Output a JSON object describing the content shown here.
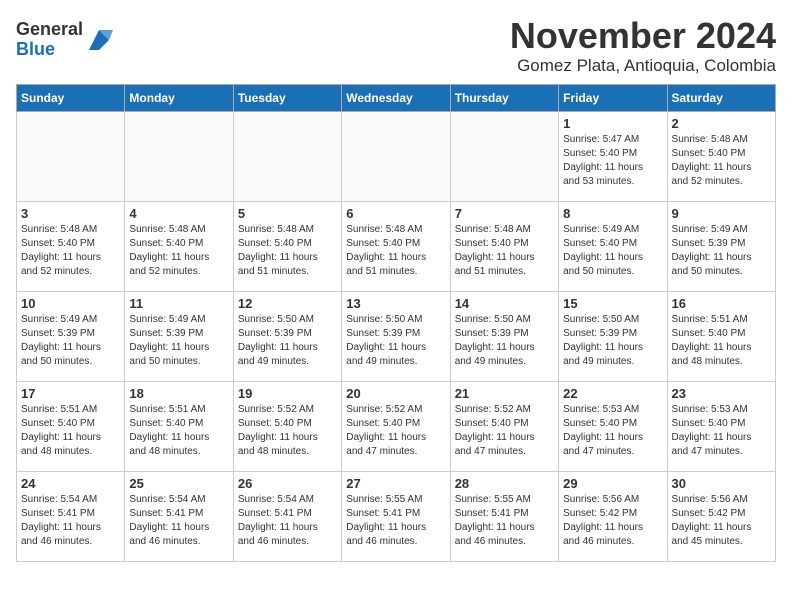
{
  "logo": {
    "general": "General",
    "blue": "Blue"
  },
  "title": "November 2024",
  "location": "Gomez Plata, Antioquia, Colombia",
  "days_of_week": [
    "Sunday",
    "Monday",
    "Tuesday",
    "Wednesday",
    "Thursday",
    "Friday",
    "Saturday"
  ],
  "weeks": [
    [
      {
        "day": "",
        "info": ""
      },
      {
        "day": "",
        "info": ""
      },
      {
        "day": "",
        "info": ""
      },
      {
        "day": "",
        "info": ""
      },
      {
        "day": "",
        "info": ""
      },
      {
        "day": "1",
        "info": "Sunrise: 5:47 AM\nSunset: 5:40 PM\nDaylight: 11 hours\nand 53 minutes."
      },
      {
        "day": "2",
        "info": "Sunrise: 5:48 AM\nSunset: 5:40 PM\nDaylight: 11 hours\nand 52 minutes."
      }
    ],
    [
      {
        "day": "3",
        "info": "Sunrise: 5:48 AM\nSunset: 5:40 PM\nDaylight: 11 hours\nand 52 minutes."
      },
      {
        "day": "4",
        "info": "Sunrise: 5:48 AM\nSunset: 5:40 PM\nDaylight: 11 hours\nand 52 minutes."
      },
      {
        "day": "5",
        "info": "Sunrise: 5:48 AM\nSunset: 5:40 PM\nDaylight: 11 hours\nand 51 minutes."
      },
      {
        "day": "6",
        "info": "Sunrise: 5:48 AM\nSunset: 5:40 PM\nDaylight: 11 hours\nand 51 minutes."
      },
      {
        "day": "7",
        "info": "Sunrise: 5:48 AM\nSunset: 5:40 PM\nDaylight: 11 hours\nand 51 minutes."
      },
      {
        "day": "8",
        "info": "Sunrise: 5:49 AM\nSunset: 5:40 PM\nDaylight: 11 hours\nand 50 minutes."
      },
      {
        "day": "9",
        "info": "Sunrise: 5:49 AM\nSunset: 5:39 PM\nDaylight: 11 hours\nand 50 minutes."
      }
    ],
    [
      {
        "day": "10",
        "info": "Sunrise: 5:49 AM\nSunset: 5:39 PM\nDaylight: 11 hours\nand 50 minutes."
      },
      {
        "day": "11",
        "info": "Sunrise: 5:49 AM\nSunset: 5:39 PM\nDaylight: 11 hours\nand 50 minutes."
      },
      {
        "day": "12",
        "info": "Sunrise: 5:50 AM\nSunset: 5:39 PM\nDaylight: 11 hours\nand 49 minutes."
      },
      {
        "day": "13",
        "info": "Sunrise: 5:50 AM\nSunset: 5:39 PM\nDaylight: 11 hours\nand 49 minutes."
      },
      {
        "day": "14",
        "info": "Sunrise: 5:50 AM\nSunset: 5:39 PM\nDaylight: 11 hours\nand 49 minutes."
      },
      {
        "day": "15",
        "info": "Sunrise: 5:50 AM\nSunset: 5:39 PM\nDaylight: 11 hours\nand 49 minutes."
      },
      {
        "day": "16",
        "info": "Sunrise: 5:51 AM\nSunset: 5:40 PM\nDaylight: 11 hours\nand 48 minutes."
      }
    ],
    [
      {
        "day": "17",
        "info": "Sunrise: 5:51 AM\nSunset: 5:40 PM\nDaylight: 11 hours\nand 48 minutes."
      },
      {
        "day": "18",
        "info": "Sunrise: 5:51 AM\nSunset: 5:40 PM\nDaylight: 11 hours\nand 48 minutes."
      },
      {
        "day": "19",
        "info": "Sunrise: 5:52 AM\nSunset: 5:40 PM\nDaylight: 11 hours\nand 48 minutes."
      },
      {
        "day": "20",
        "info": "Sunrise: 5:52 AM\nSunset: 5:40 PM\nDaylight: 11 hours\nand 47 minutes."
      },
      {
        "day": "21",
        "info": "Sunrise: 5:52 AM\nSunset: 5:40 PM\nDaylight: 11 hours\nand 47 minutes."
      },
      {
        "day": "22",
        "info": "Sunrise: 5:53 AM\nSunset: 5:40 PM\nDaylight: 11 hours\nand 47 minutes."
      },
      {
        "day": "23",
        "info": "Sunrise: 5:53 AM\nSunset: 5:40 PM\nDaylight: 11 hours\nand 47 minutes."
      }
    ],
    [
      {
        "day": "24",
        "info": "Sunrise: 5:54 AM\nSunset: 5:41 PM\nDaylight: 11 hours\nand 46 minutes."
      },
      {
        "day": "25",
        "info": "Sunrise: 5:54 AM\nSunset: 5:41 PM\nDaylight: 11 hours\nand 46 minutes."
      },
      {
        "day": "26",
        "info": "Sunrise: 5:54 AM\nSunset: 5:41 PM\nDaylight: 11 hours\nand 46 minutes."
      },
      {
        "day": "27",
        "info": "Sunrise: 5:55 AM\nSunset: 5:41 PM\nDaylight: 11 hours\nand 46 minutes."
      },
      {
        "day": "28",
        "info": "Sunrise: 5:55 AM\nSunset: 5:41 PM\nDaylight: 11 hours\nand 46 minutes."
      },
      {
        "day": "29",
        "info": "Sunrise: 5:56 AM\nSunset: 5:42 PM\nDaylight: 11 hours\nand 46 minutes."
      },
      {
        "day": "30",
        "info": "Sunrise: 5:56 AM\nSunset: 5:42 PM\nDaylight: 11 hours\nand 45 minutes."
      }
    ]
  ]
}
